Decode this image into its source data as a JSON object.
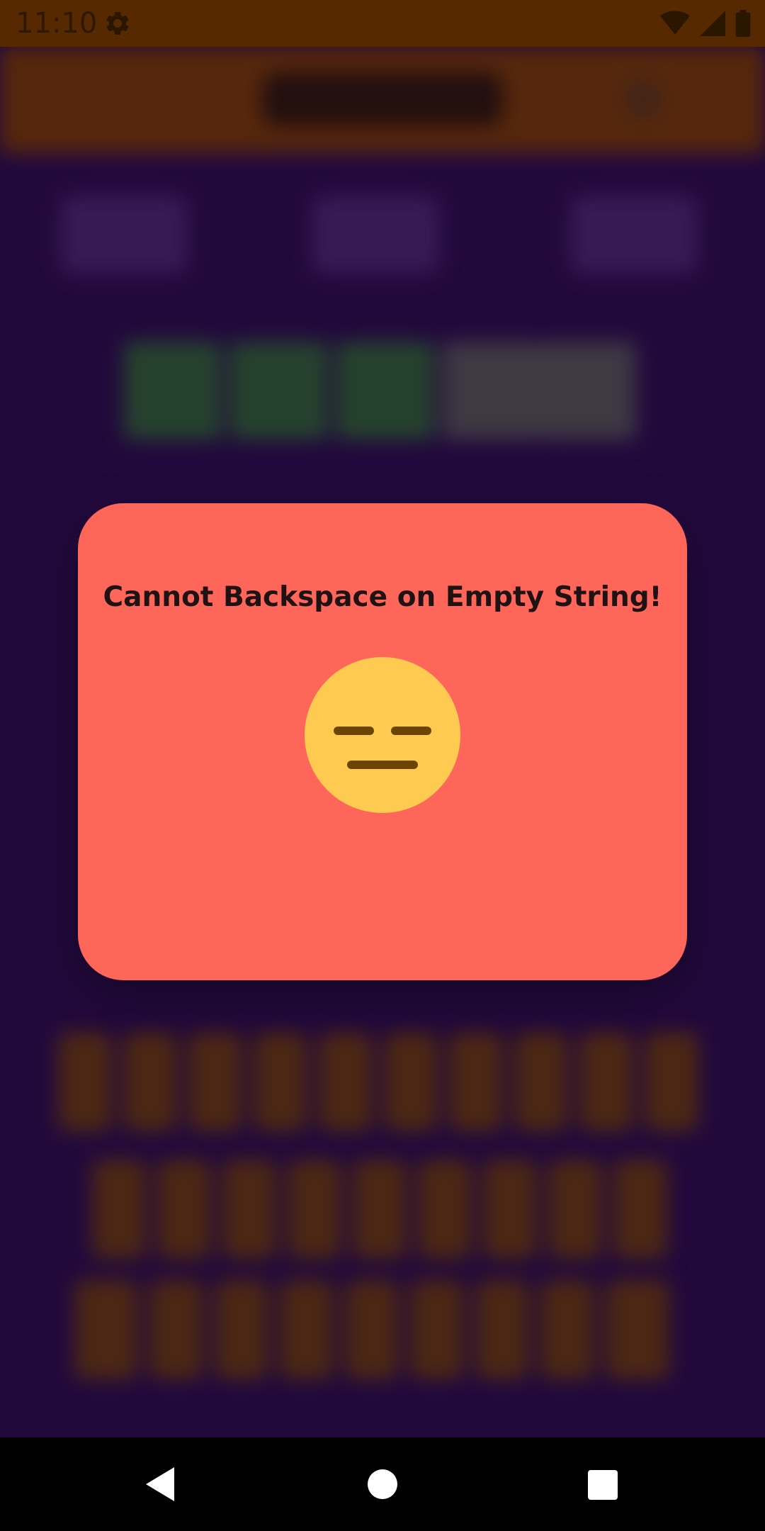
{
  "status_bar": {
    "time": "11:10",
    "icons": [
      "gear-icon",
      "wifi-icon",
      "signal-icon",
      "battery-icon"
    ]
  },
  "dialog": {
    "message": "Cannot Backspace on Empty String!",
    "emoji": "expressionless-face-icon",
    "background_color": "#ff665a"
  },
  "navigation": {
    "buttons": [
      "back-icon",
      "home-icon",
      "recents-icon"
    ]
  },
  "colors": {
    "background": "#2a0b4a",
    "app_bar": "#7a3a00",
    "emoji_face": "#ffca50",
    "emoji_features": "#6b4400"
  }
}
